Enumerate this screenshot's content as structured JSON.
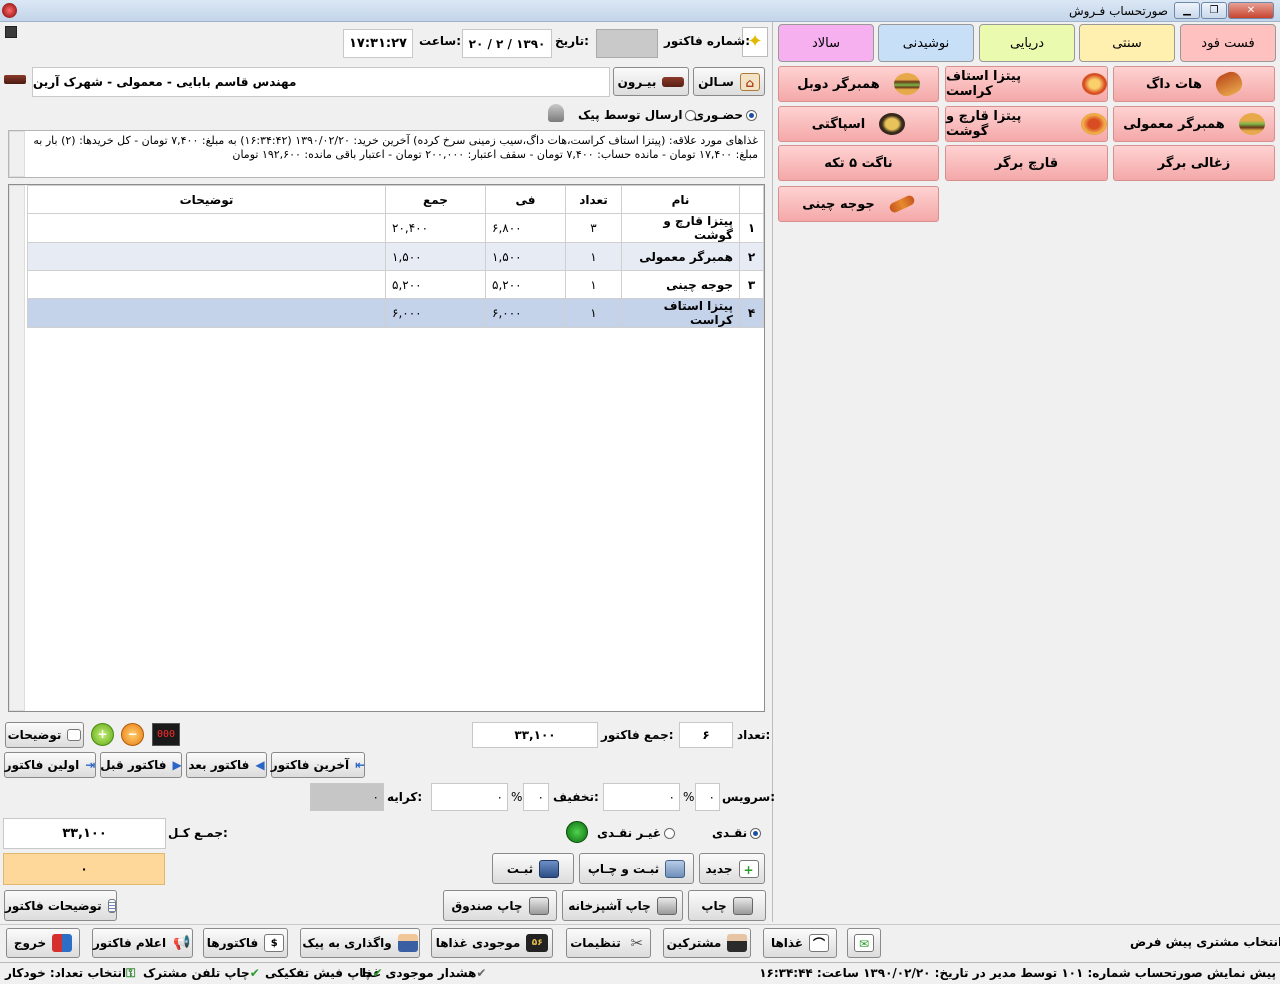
{
  "window": {
    "title": "صورتحساب فـروش"
  },
  "colors": {
    "fastfood": "#ffb8b8",
    "traditional": "#ffe6a8",
    "seafood": "#e2f9a8",
    "drinks": "#bcd9f5",
    "salad": "#f4a8f0",
    "food_button": "#f7b2b2",
    "yellow_box": "#fdd89a"
  },
  "categories": [
    {
      "label": "فست فود",
      "color": "#ffc0c0"
    },
    {
      "label": "سنتی",
      "color": "#fff0b0"
    },
    {
      "label": "دریایی",
      "color": "#eafbb0"
    },
    {
      "label": "نوشیدنی",
      "color": "#c7e0f8"
    },
    {
      "label": "سالاد",
      "color": "#f6b0f0"
    }
  ],
  "foods": [
    {
      "label": "هات داگ",
      "icon": "hotdog-icon"
    },
    {
      "label": "پیتزا استاف کراست",
      "icon": "pizza-icon"
    },
    {
      "label": "همبرگر دوبل",
      "icon": "double-burger-icon"
    },
    {
      "label": "همبرگر معمولی",
      "icon": "burger-icon"
    },
    {
      "label": "پیتزا قارچ و گوشت",
      "icon": "pizza-icon"
    },
    {
      "label": "اسپاگتی",
      "icon": "spaghetti-icon"
    },
    {
      "label": "زغالی برگر",
      "icon": ""
    },
    {
      "label": "قارچ برگر",
      "icon": ""
    },
    {
      "label": "ناگت ۵ تکه",
      "icon": ""
    },
    {
      "label": "جوجه چینی",
      "icon": "skewer-icon"
    }
  ],
  "header": {
    "invoice_no_label": "شماره فاکتور:",
    "invoice_no_value": "",
    "date_label": "تاریخ:",
    "date_value": "۲۰ / ۲ / ۱۳۹۰",
    "time_label": "ساعت:",
    "time_value": "۱۷:۳۱:۲۷"
  },
  "order_type": {
    "salon": "سـالن",
    "outside": "بیـرون"
  },
  "customer": {
    "name": "مهندس قاسم بابایی - معمولی - شهرک آرین"
  },
  "delivery": {
    "in_person": "حضـوری",
    "by_courier": "ارسال توسط پیک",
    "selected": "in_person"
  },
  "customer_info": {
    "line1": "غذاهای مورد علاقه: (پیتزا استاف کراست،هات داگ،سیب زمینی سرخ کرده) آخرین خرید: ۱۳۹۰/۰۲/۲۰ (۱۶:۳۴:۴۲) به مبلغ: ۷,۴۰۰ تومان - کل خریدها: (۲) بار به",
    "line2": "مبلغ: ۱۷,۴۰۰ تومان - مانده حساب: ۷,۴۰۰ تومان -  سقف اعتبار: ۲۰۰,۰۰۰ تومان -  اعتبار باقی مانده: ۱۹۲,۶۰۰ تومان"
  },
  "grid": {
    "columns": [
      "نام",
      "تعداد",
      "فی",
      "جمع",
      "توضیحات"
    ],
    "rows": [
      {
        "idx": "۱",
        "name": "پیتزا قارچ و گوشت",
        "qty": "۳",
        "price": "۶,۸۰۰",
        "total": "۲۰,۴۰۰",
        "note": ""
      },
      {
        "idx": "۲",
        "name": "همبرگر معمولی",
        "qty": "۱",
        "price": "۱,۵۰۰",
        "total": "۱,۵۰۰",
        "note": ""
      },
      {
        "idx": "۳",
        "name": "جوجه چینی",
        "qty": "۱",
        "price": "۵,۲۰۰",
        "total": "۵,۲۰۰",
        "note": ""
      },
      {
        "idx": "۴",
        "name": "پیتزا استاف کراست",
        "qty": "۱",
        "price": "۶,۰۰۰",
        "total": "۶,۰۰۰",
        "note": ""
      }
    ]
  },
  "totals": {
    "count_label": "تعداد:",
    "count_value": "۶",
    "invoice_total_label": "جمع فاکتور:",
    "invoice_total_value": "۳۳,۱۰۰",
    "service_label": "سرویس:",
    "service_pct": "۰",
    "service_amount": "۰",
    "discount_label": "تخفیف:",
    "discount_pct": "۰",
    "discount_amount": "۰",
    "rent_label": "کرایه:",
    "rent_value": "۰",
    "grand_total_label": "جمـع کـل:",
    "grand_total_value": "۳۳,۱۰۰",
    "yellow_value": "۰",
    "pct_sign": "%"
  },
  "payment": {
    "cash": "نقـدی",
    "non_cash": "غیـر نقـدی",
    "selected": "cash"
  },
  "nav": {
    "notes": "توضیحات",
    "last": "آخرین فاکتور",
    "next": "فاکتور بعد",
    "prev": "فاکتور قبل",
    "first": "اولین فاکتور"
  },
  "actions": {
    "new": "جدید",
    "save_print": "ثبـت و چـاپ",
    "save": "ثبـت",
    "print": "چاپ",
    "print_kitchen": "چاپ آشپزخانه",
    "print_cashbox": "چاپ صندوق",
    "invoice_notes": "توضیحات فاکتور"
  },
  "default_customer": {
    "label": "انتخاب مشتری پیش فرض",
    "checked": true
  },
  "toolbar": {
    "foods": "غذاها",
    "customers": "مشترکین",
    "settings": "تنظیمات",
    "food_stock": "موجودی غذاها",
    "assign_courier": "واگذاری به پیک",
    "invoices": "فاکتورها",
    "announce": "اعلام فاکتور",
    "exit": "خروج"
  },
  "statusbar": {
    "left": "پیش نمایش صورتحساب شماره: ۱۰۱ توسط مدیر در تاریخ: ۱۳۹۰/۰۲/۲۰ ساعت: ۱۶:۳۴:۴۴",
    "warn_stock": "هشدار موجودی غذا",
    "print_split": "چاپ فیش تفکیکی",
    "print_phone": "چاپ تلفن مشترک",
    "auto_count": "انتخاب تعداد: خودکار"
  }
}
